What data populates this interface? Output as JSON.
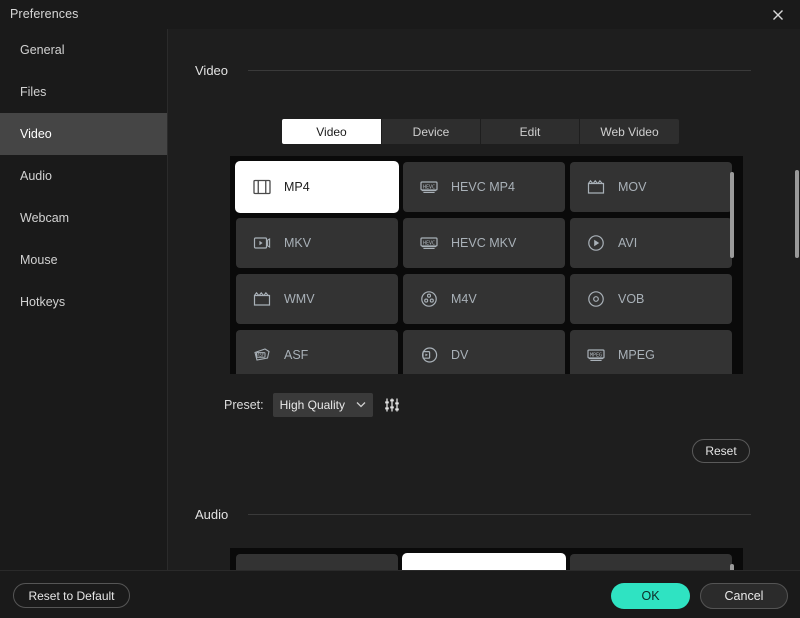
{
  "window": {
    "title": "Preferences",
    "close_icon": "close-icon"
  },
  "sidebar": {
    "items": [
      {
        "label": "General",
        "active": false
      },
      {
        "label": "Files",
        "active": false
      },
      {
        "label": "Video",
        "active": true
      },
      {
        "label": "Audio",
        "active": false
      },
      {
        "label": "Webcam",
        "active": false
      },
      {
        "label": "Mouse",
        "active": false
      },
      {
        "label": "Hotkeys",
        "active": false
      }
    ]
  },
  "main": {
    "video_section": {
      "title": "Video",
      "tabs": [
        {
          "label": "Video",
          "active": true
        },
        {
          "label": "Device",
          "active": false
        },
        {
          "label": "Edit",
          "active": false
        },
        {
          "label": "Web Video",
          "active": false
        }
      ],
      "formats": [
        {
          "label": "MP4",
          "icon": "film-strip-icon",
          "selected": true
        },
        {
          "label": "HEVC MP4",
          "icon": "hevc-badge-icon",
          "selected": false
        },
        {
          "label": "MOV",
          "icon": "clapperboard-icon",
          "selected": false
        },
        {
          "label": "MKV",
          "icon": "play-box-icon",
          "selected": false
        },
        {
          "label": "HEVC MKV",
          "icon": "hevc-badge-icon",
          "selected": false
        },
        {
          "label": "AVI",
          "icon": "play-circle-icon",
          "selected": false
        },
        {
          "label": "WMV",
          "icon": "clapperboard-icon",
          "selected": false
        },
        {
          "label": "M4V",
          "icon": "film-reel-icon",
          "selected": false
        },
        {
          "label": "VOB",
          "icon": "disc-icon",
          "selected": false
        },
        {
          "label": "ASF",
          "icon": "asf-badge-icon",
          "selected": false
        },
        {
          "label": "DV",
          "icon": "dv-circle-icon",
          "selected": false
        },
        {
          "label": "MPEG",
          "icon": "mpeg-badge-icon",
          "selected": false
        }
      ],
      "preset_label": "Preset:",
      "preset_value": "High Quality",
      "preset_chevron": "chevron-down-icon",
      "settings_icon": "equalizer-icon",
      "reset_label": "Reset"
    },
    "audio_section": {
      "title": "Audio"
    }
  },
  "footer": {
    "reset_to_default_label": "Reset to Default",
    "ok_label": "OK",
    "cancel_label": "Cancel"
  },
  "colors": {
    "accent": "#2fe3c2",
    "window_bg": "#1e1e1e",
    "sidebar_bg": "#1a1a1a",
    "tile_bg": "#333333",
    "grid_gutter": "#0a0a0a",
    "scrollbar": "#9a9a9a"
  }
}
